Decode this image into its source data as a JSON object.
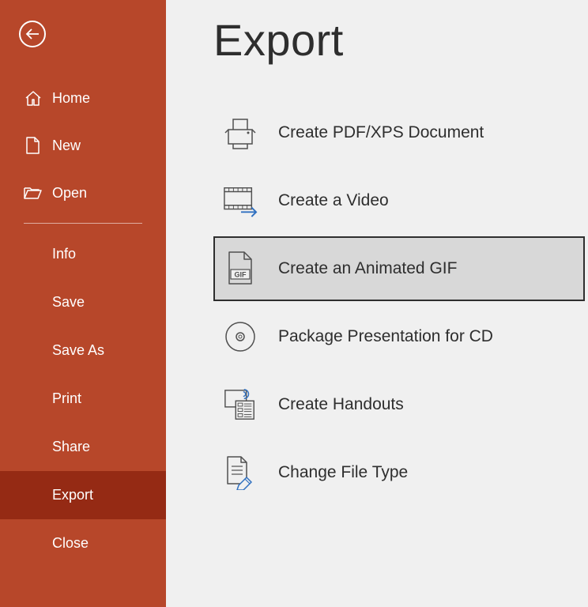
{
  "page": {
    "title": "Export"
  },
  "sidebar": {
    "top": [
      {
        "label": "Home",
        "icon": "home"
      },
      {
        "label": "New",
        "icon": "new"
      },
      {
        "label": "Open",
        "icon": "open"
      }
    ],
    "bottom": [
      {
        "label": "Info"
      },
      {
        "label": "Save"
      },
      {
        "label": "Save As"
      },
      {
        "label": "Print"
      },
      {
        "label": "Share"
      },
      {
        "label": "Export",
        "active": true
      },
      {
        "label": "Close"
      }
    ]
  },
  "export_options": [
    {
      "label": "Create PDF/XPS Document",
      "icon": "pdf"
    },
    {
      "label": "Create a Video",
      "icon": "video"
    },
    {
      "label": "Create an Animated GIF",
      "icon": "gif",
      "selected": true
    },
    {
      "label": "Package Presentation for CD",
      "icon": "cd"
    },
    {
      "label": "Create Handouts",
      "icon": "handouts"
    },
    {
      "label": "Change File Type",
      "icon": "filetype"
    }
  ]
}
